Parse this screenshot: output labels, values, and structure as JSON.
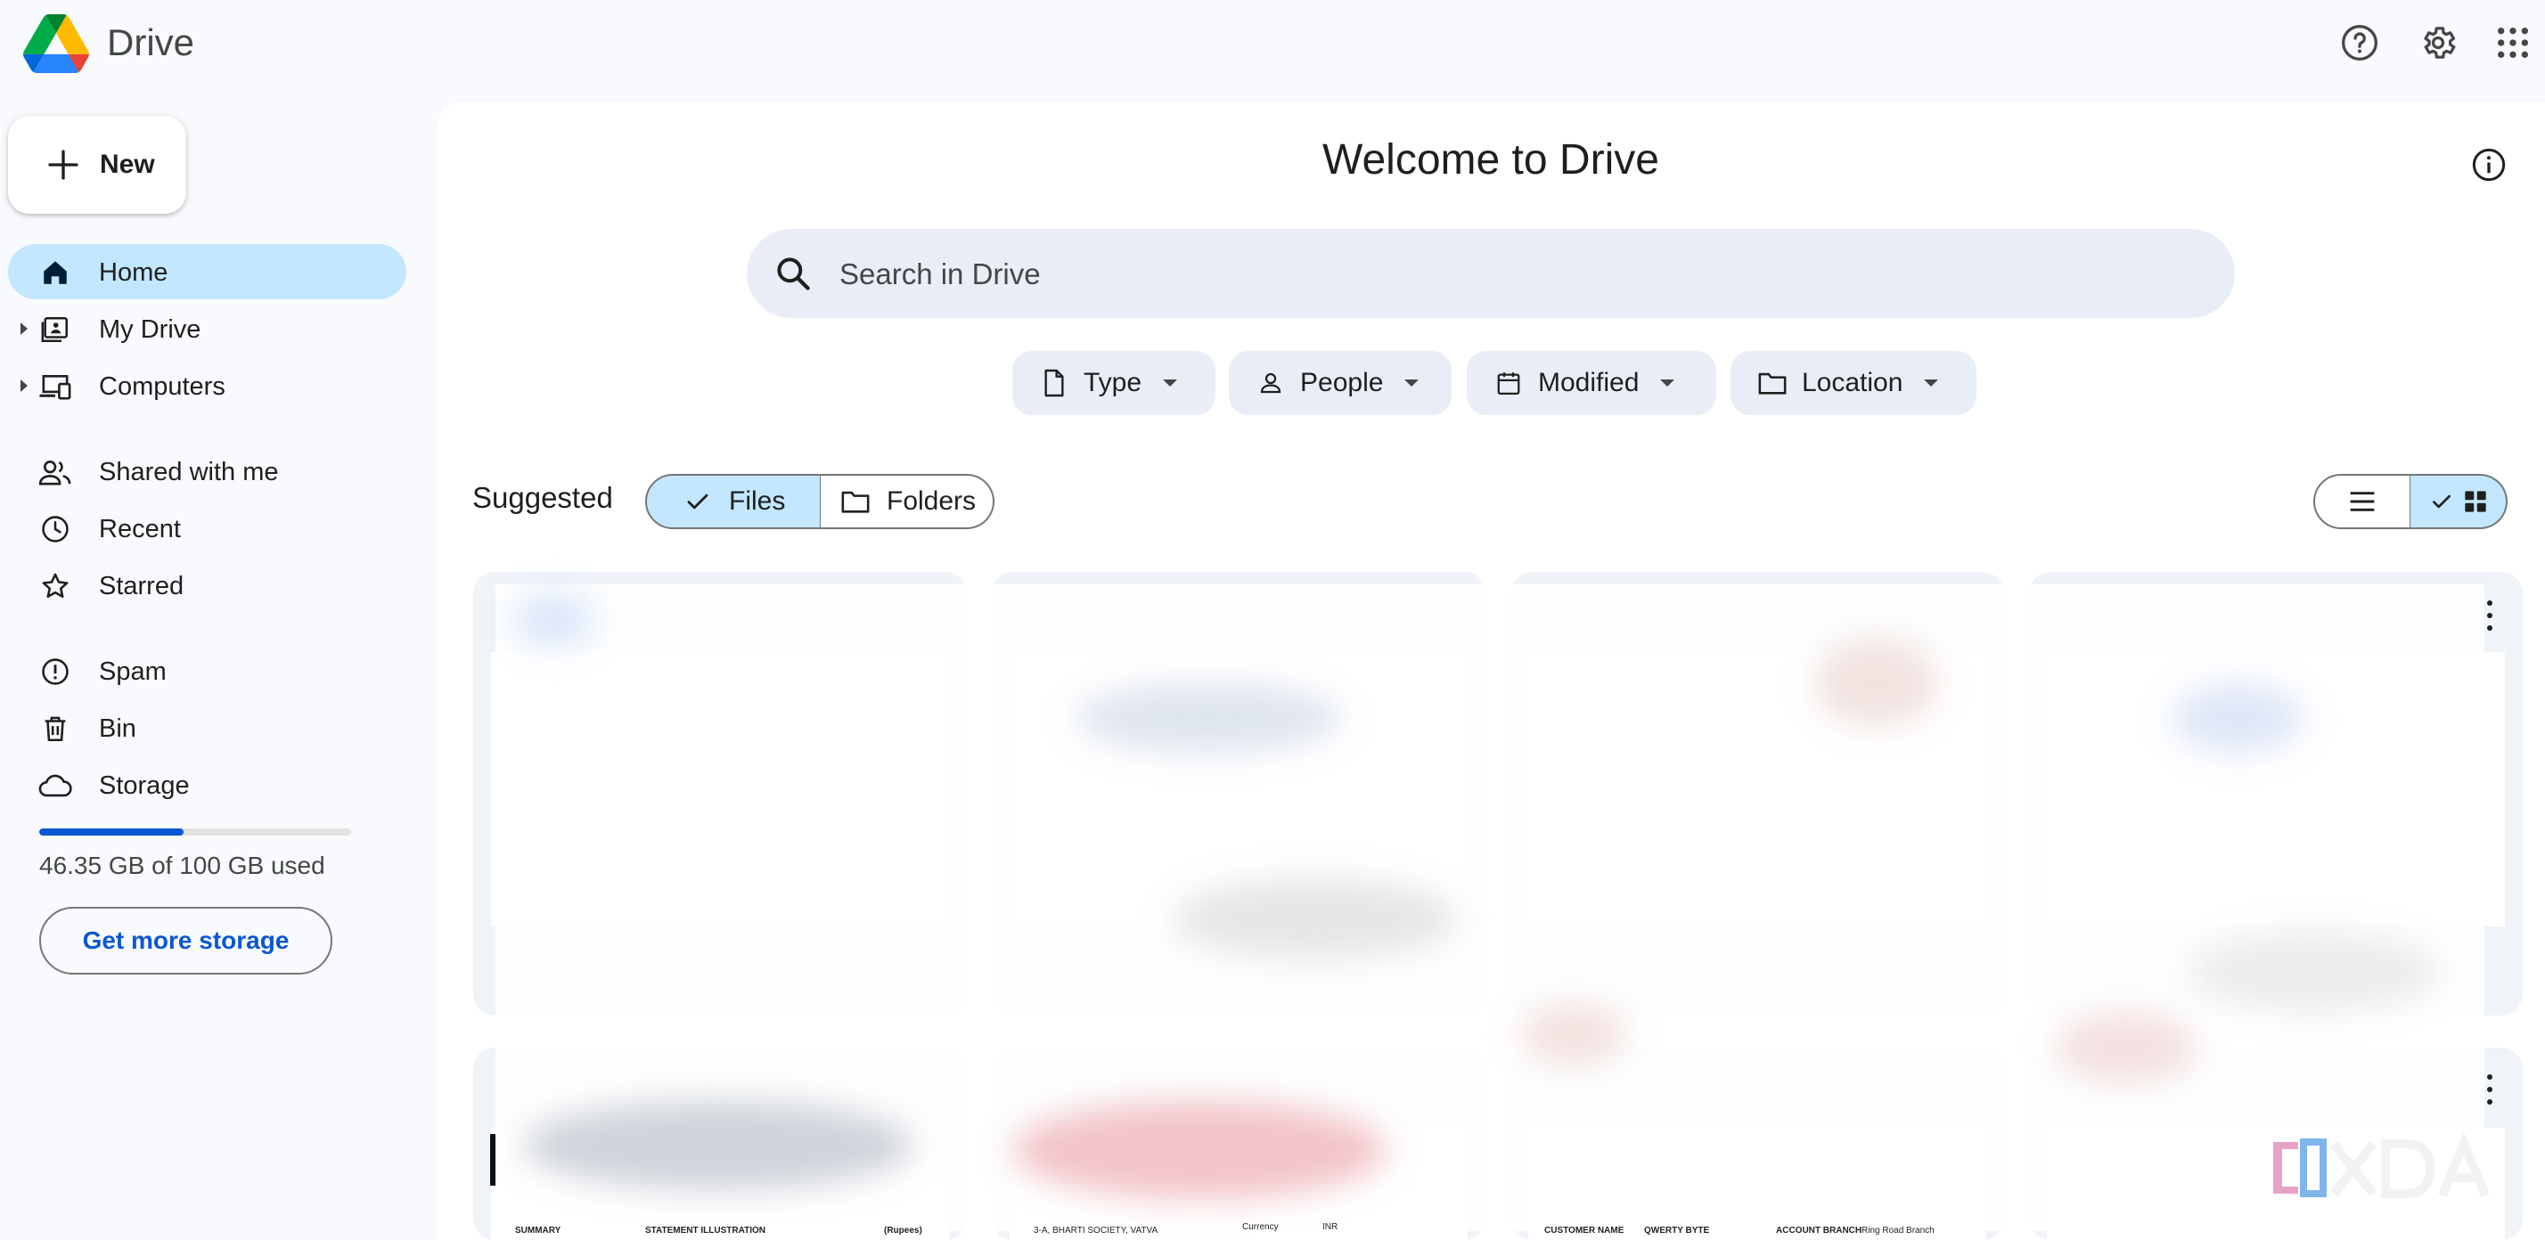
{
  "app": {
    "title": "Drive"
  },
  "header": {
    "icons": [
      "help-icon",
      "settings-icon",
      "apps-grid-icon"
    ]
  },
  "sidebar": {
    "new_label": "New",
    "items": [
      {
        "label": "Home",
        "icon": "home-icon",
        "active": true
      },
      {
        "label": "My Drive",
        "icon": "my-drive-icon",
        "expandable": true
      },
      {
        "label": "Computers",
        "icon": "computers-icon",
        "expandable": true
      },
      {
        "label": "Shared with me",
        "icon": "shared-icon"
      },
      {
        "label": "Recent",
        "icon": "clock-icon"
      },
      {
        "label": "Starred",
        "icon": "star-icon"
      },
      {
        "label": "Spam",
        "icon": "spam-icon"
      },
      {
        "label": "Bin",
        "icon": "bin-icon"
      },
      {
        "label": "Storage",
        "icon": "cloud-icon"
      }
    ],
    "storage": {
      "used_text": "46.35 GB of 100 GB used",
      "used_fraction": 0.4635,
      "button_label": "Get more storage"
    }
  },
  "main": {
    "welcome": "Welcome to Drive",
    "search_placeholder": "Search in Drive",
    "filters": [
      {
        "label": "Type",
        "icon": "file-icon"
      },
      {
        "label": "People",
        "icon": "person-icon"
      },
      {
        "label": "Modified",
        "icon": "calendar-icon"
      },
      {
        "label": "Location",
        "icon": "folder-icon"
      }
    ],
    "suggested_title": "Suggested",
    "segments": {
      "files": "Files",
      "folders": "Folders",
      "selected": "files"
    },
    "view_mode": "grid",
    "doc_snippets": [
      "SUMMARY",
      "STATEMENT ILLUSTRATION",
      "(Rupees)",
      "3-A, BHARTI SOCIETY, VATVA",
      "Currency",
      "INR",
      "CUSTOMER NAME",
      "QWERTY BYTE",
      "ACCOUNT BRANCH",
      "Ring Road Branch"
    ]
  },
  "watermark": "XDA",
  "colors": {
    "accent": "#0b57d0",
    "active_bg": "#c2e7ff",
    "chip_bg": "#e9eef6",
    "page_bg": "#f8fafd"
  }
}
